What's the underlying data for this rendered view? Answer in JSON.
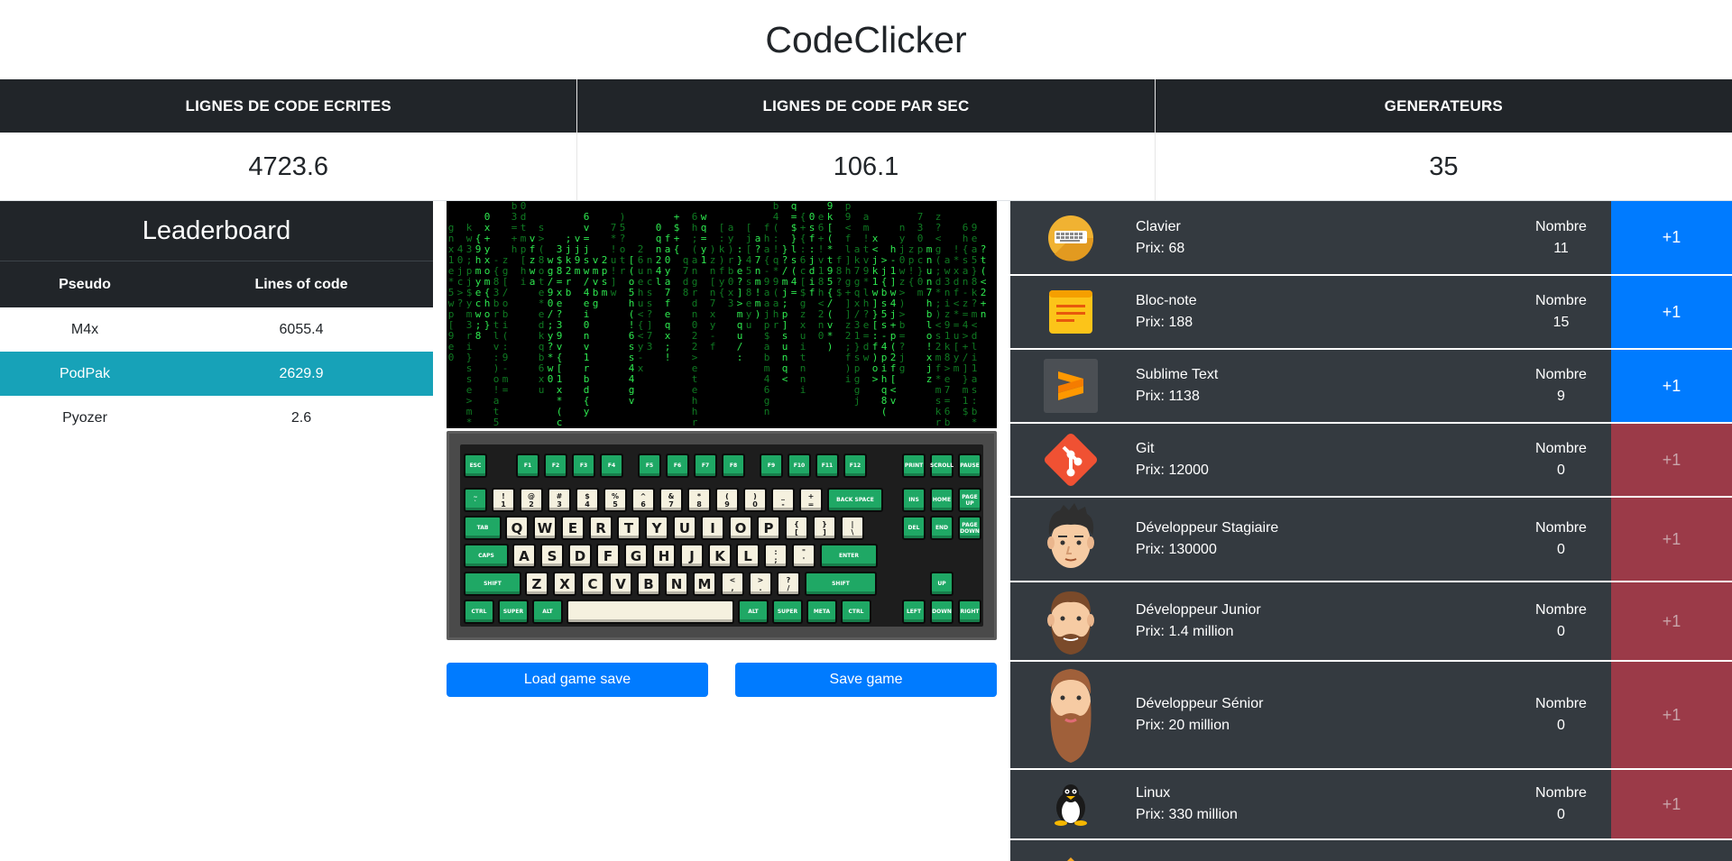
{
  "app": {
    "title": "CodeClicker"
  },
  "stats": [
    {
      "label": "LIGNES DE CODE ECRITES",
      "value": "4723.6"
    },
    {
      "label": "LIGNES DE CODE PAR SEC",
      "value": "106.1"
    },
    {
      "label": "GENERATEURS",
      "value": "35"
    }
  ],
  "leaderboard": {
    "title": "Leaderboard",
    "columns": [
      "Pseudo",
      "Lines of code"
    ],
    "rows": [
      {
        "pseudo": "M4x",
        "lines": "6055.4"
      },
      {
        "pseudo": "PodPak",
        "lines": "2629.9",
        "highlighted": true
      },
      {
        "pseudo": "Pyozer",
        "lines": "2.6"
      }
    ]
  },
  "keyboard": {
    "row_fn": [
      "ESC",
      "F1",
      "F2",
      "F3",
      "F4",
      "F5",
      "F6",
      "F7",
      "F8",
      "F9",
      "F10",
      "F11",
      "F12",
      "PRINT",
      "SCROLL",
      "PAUSE"
    ],
    "row_num": [
      "~\n`",
      "!\n1",
      "@\n2",
      "#\n3",
      "$\n4",
      "%\n5",
      "^\n6",
      "&\n7",
      "*\n8",
      "(\n9",
      ")\n0",
      "_\n-",
      "+\n=",
      "BACK SPACE",
      "INS",
      "HOME",
      "PAGE UP"
    ],
    "row_q": [
      "TAB",
      "Q",
      "W",
      "E",
      "R",
      "T",
      "Y",
      "U",
      "I",
      "O",
      "P",
      "{\n[",
      "}\n]",
      "|\n\\",
      "DEL",
      "END",
      "PAGE DOWN"
    ],
    "row_a": [
      "CAPS",
      "A",
      "S",
      "D",
      "F",
      "G",
      "H",
      "J",
      "K",
      "L",
      ":\n;",
      "\"\n'",
      "ENTER"
    ],
    "row_z": [
      "SHIFT",
      "Z",
      "X",
      "C",
      "V",
      "B",
      "N",
      "M",
      "<\n,",
      ">\n.",
      "?\n/",
      "SHIFT",
      "UP"
    ],
    "row_bottom": [
      "CTRL",
      "SUPER",
      "ALT",
      "",
      "ALT",
      "SUPER",
      "META",
      "CTRL",
      "LEFT",
      "DOWN",
      "RIGHT"
    ]
  },
  "buttons": {
    "load": "Load game save",
    "save": "Save game"
  },
  "generators": [
    {
      "name": "Clavier",
      "price": "Prix: 68",
      "count_label": "Nombre",
      "count": "11",
      "buy": "+1",
      "affordable": true,
      "icon": "keyboard-icon"
    },
    {
      "name": "Bloc-note",
      "price": "Prix: 188",
      "count_label": "Nombre",
      "count": "15",
      "buy": "+1",
      "affordable": true,
      "icon": "notepad-icon"
    },
    {
      "name": "Sublime Text",
      "price": "Prix: 1138",
      "count_label": "Nombre",
      "count": "9",
      "buy": "+1",
      "affordable": true,
      "icon": "sublime-text-icon"
    },
    {
      "name": "Git",
      "price": "Prix: 12000",
      "count_label": "Nombre",
      "count": "0",
      "buy": "+1",
      "affordable": false,
      "icon": "git-icon"
    },
    {
      "name": "Développeur Stagiaire",
      "price": "Prix: 130000",
      "count_label": "Nombre",
      "count": "0",
      "buy": "+1",
      "affordable": false,
      "icon": "intern-developer-icon"
    },
    {
      "name": "Développeur Junior",
      "price": "Prix: 1.4 million",
      "count_label": "Nombre",
      "count": "0",
      "buy": "+1",
      "affordable": false,
      "icon": "junior-developer-icon"
    },
    {
      "name": "Développeur Sénior",
      "price": "Prix: 20 million",
      "count_label": "Nombre",
      "count": "0",
      "buy": "+1",
      "affordable": false,
      "icon": "senior-developer-icon"
    },
    {
      "name": "Linux",
      "price": "Prix: 330 million",
      "count_label": "Nombre",
      "count": "0",
      "buy": "+1",
      "affordable": false,
      "icon": "linux-tux-icon"
    }
  ]
}
